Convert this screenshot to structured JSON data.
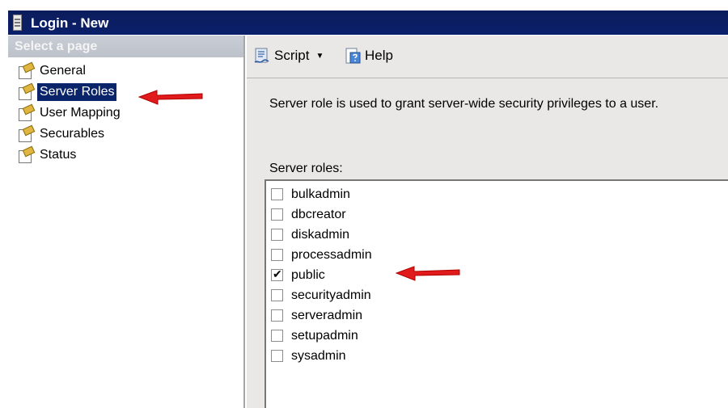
{
  "window": {
    "title": "Login - New"
  },
  "sidebar": {
    "header": "Select a page",
    "items": [
      {
        "label": "General",
        "selected": false
      },
      {
        "label": "Server Roles",
        "selected": true
      },
      {
        "label": "User Mapping",
        "selected": false
      },
      {
        "label": "Securables",
        "selected": false
      },
      {
        "label": "Status",
        "selected": false
      }
    ]
  },
  "toolbar": {
    "script_label": "Script",
    "help_label": "Help"
  },
  "main": {
    "description": "Server role is used to grant server-wide security privileges to a user.",
    "roles_label": "Server roles:",
    "roles": [
      {
        "name": "bulkadmin",
        "checked": false
      },
      {
        "name": "dbcreator",
        "checked": false
      },
      {
        "name": "diskadmin",
        "checked": false
      },
      {
        "name": "processadmin",
        "checked": false
      },
      {
        "name": "public",
        "checked": true
      },
      {
        "name": "securityadmin",
        "checked": false
      },
      {
        "name": "serveradmin",
        "checked": false
      },
      {
        "name": "setupadmin",
        "checked": false
      },
      {
        "name": "sysadmin",
        "checked": false
      }
    ]
  },
  "colors": {
    "title_bar": "#0a1f6a",
    "selection": "#0a246a",
    "annotation_arrow": "#e11b1b",
    "panel_bg": "#e9e8e6"
  }
}
